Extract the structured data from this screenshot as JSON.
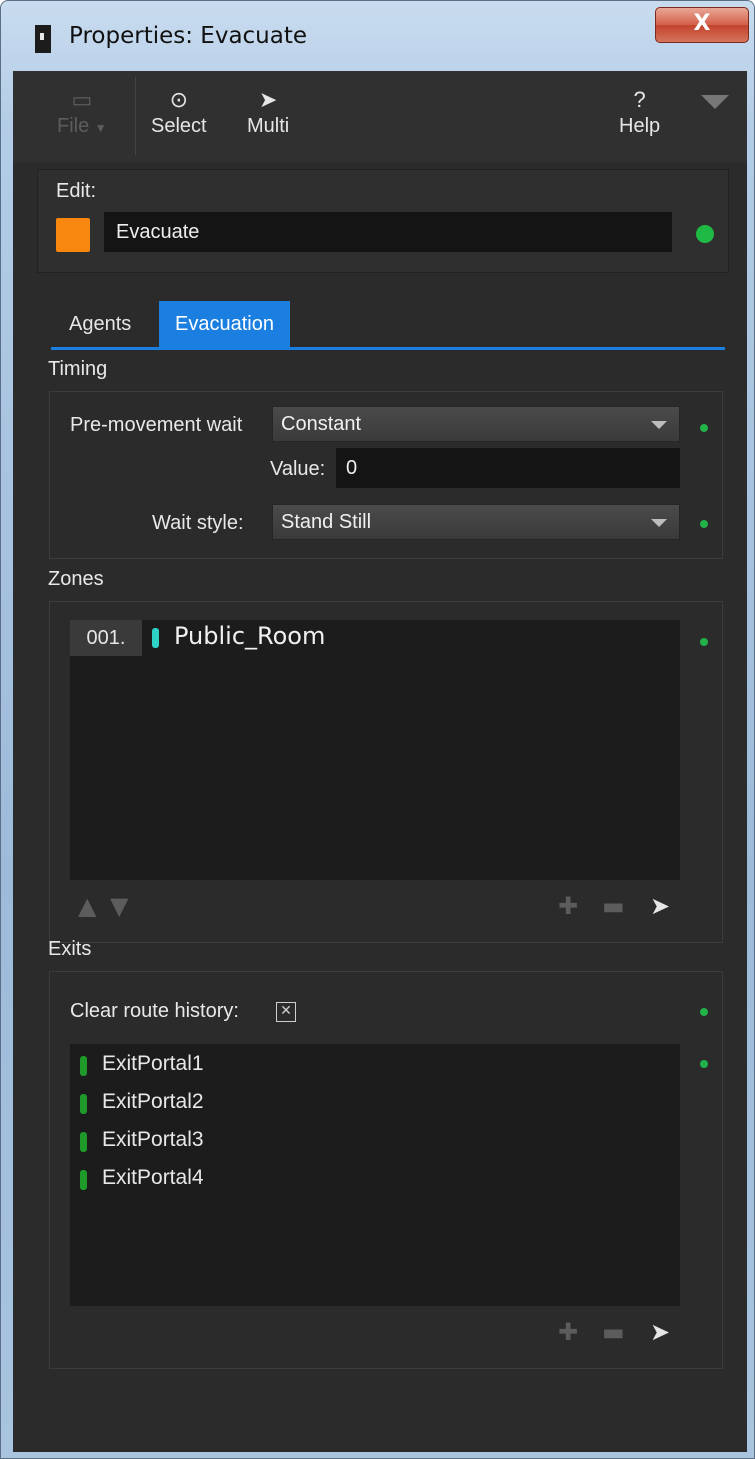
{
  "window": {
    "title": "Properties: Evacuate",
    "close_label": "X"
  },
  "toolbar": {
    "file_label": "File",
    "select_label": "Select",
    "multi_label": "Multi",
    "help_label": "Help"
  },
  "edit": {
    "label": "Edit:",
    "name_value": "Evacuate",
    "swatch_color": "#f7870f"
  },
  "tabs": [
    {
      "label": "Agents",
      "active": false
    },
    {
      "label": "Evacuation",
      "active": true
    }
  ],
  "timing": {
    "title": "Timing",
    "pre_movement_label": "Pre-movement wait",
    "pre_movement_value": "Constant",
    "value_label": "Value:",
    "value": "0",
    "wait_style_label": "Wait style:",
    "wait_style_value": "Stand Still"
  },
  "zones": {
    "title": "Zones",
    "items": [
      {
        "index": "001.",
        "name": "Public_Room",
        "color": "#2ed3c8"
      }
    ]
  },
  "exits": {
    "title": "Exits",
    "clear_route_label": "Clear route history:",
    "clear_route_checked": true,
    "checkbox_glyph": "✕",
    "items": [
      {
        "name": "ExitPortal1",
        "color": "#1f9a2a"
      },
      {
        "name": "ExitPortal2",
        "color": "#1f9a2a"
      },
      {
        "name": "ExitPortal3",
        "color": "#1f9a2a"
      },
      {
        "name": "ExitPortal4",
        "color": "#1f9a2a"
      }
    ]
  },
  "colors": {
    "accent": "#1a7fe0",
    "status_dot": "#1fba45"
  }
}
